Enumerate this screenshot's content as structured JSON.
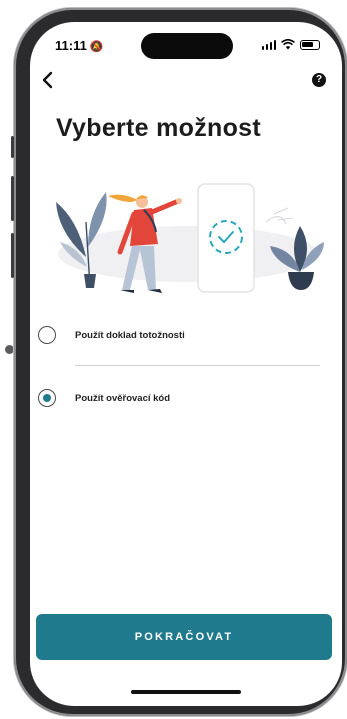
{
  "status_bar": {
    "time": "11:11"
  },
  "header": {
    "help_label": "?"
  },
  "page": {
    "title": "Vyberte možnost"
  },
  "options": [
    {
      "label": "Použít doklad totožnosti",
      "selected": false
    },
    {
      "label": "Použít ověřovací kód",
      "selected": true
    }
  ],
  "footer": {
    "continue_label": "POKRAČOVAT"
  },
  "colors": {
    "accent": "#1f7a8d",
    "title": "#1c1c1c"
  }
}
